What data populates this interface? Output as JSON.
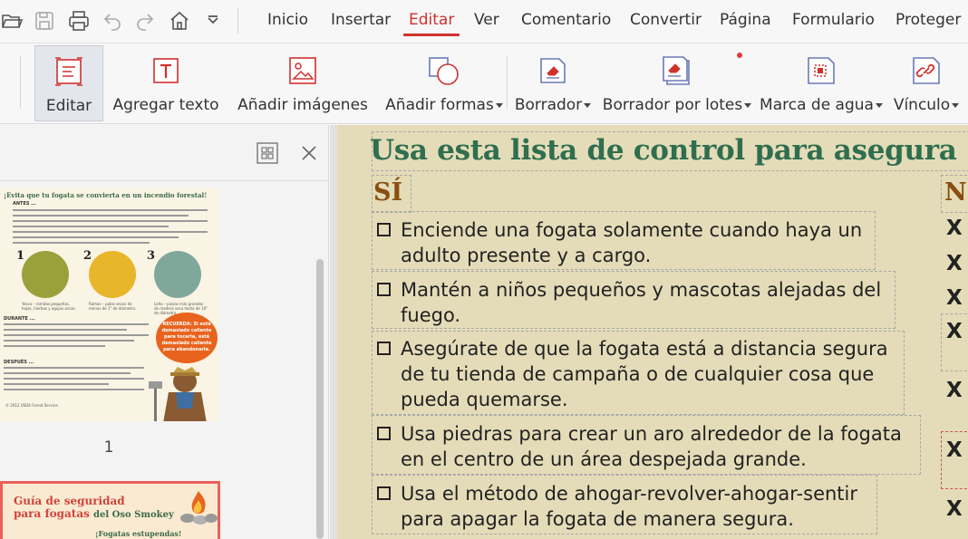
{
  "menu": {
    "tabs": [
      {
        "label": "Inicio",
        "active": false
      },
      {
        "label": "Insertar",
        "active": false
      },
      {
        "label": "Editar",
        "active": true
      },
      {
        "label": "Ver",
        "active": false
      },
      {
        "label": "Comentario",
        "active": false
      },
      {
        "label": "Convertir",
        "active": false
      },
      {
        "label": "Página",
        "active": false
      },
      {
        "label": "Formulario",
        "active": false
      },
      {
        "label": "Proteger",
        "active": false
      }
    ],
    "quick_access_icons": [
      "open-folder-icon",
      "save-icon",
      "print-icon",
      "undo-icon",
      "redo-icon",
      "home-icon",
      "chevron-down-icon"
    ]
  },
  "ribbon": {
    "buttons": [
      {
        "label": "Editar",
        "icon": "edit-text-icon",
        "active": true,
        "has_dropdown": false
      },
      {
        "label": "Agregar texto",
        "icon": "add-text-icon",
        "active": false,
        "has_dropdown": false
      },
      {
        "label": "Añadir imágenes",
        "icon": "add-image-icon",
        "active": false,
        "has_dropdown": false
      },
      {
        "label": "Añadir formas",
        "icon": "add-shape-icon",
        "active": false,
        "has_dropdown": true
      },
      {
        "label": "Borrador",
        "icon": "eraser-icon",
        "active": false,
        "has_dropdown": true
      },
      {
        "label": "Borrador por lotes",
        "icon": "batch-eraser-icon",
        "active": false,
        "has_dropdown": true
      },
      {
        "label": "Marca de agua",
        "icon": "watermark-icon",
        "active": false,
        "has_dropdown": true
      },
      {
        "label": "Vínculo",
        "icon": "link-icon",
        "active": false,
        "has_dropdown": true
      }
    ],
    "notification_color": "#e23b3b"
  },
  "sidebar": {
    "page_label": "1",
    "thumb1": {
      "title": "¡Evita que tu fogata se convierta en un incendio forestal!",
      "antes": "ANTES ...",
      "durante": "DURANTE ...",
      "despues": "DESPUÉS ...",
      "numbers": [
        "1",
        "2",
        "3"
      ],
      "captions": [
        "Yesca – ramitas pequeñas, hojas, hierbas y agujas secas.",
        "Ramas – palos secos de menos de 1\" de diámetro.",
        "Leña – piezas más grandes de madera seca hasta de 10\" de diámetro."
      ],
      "remember": "RECUERDA: Si está demasiado caliente para tocarla, está demasiado caliente para abandonarla.",
      "footer": "© 2012 USDA Forest Service."
    },
    "thumb2": {
      "title_line1": "Guía de seguridad",
      "title_line2": "para fogatas",
      "title_suffix": "del Oso Smokey",
      "subtitle": "¡Fogatas estupendas!"
    },
    "active_border_color": "#e8615a"
  },
  "document": {
    "heading": "Usa esta lista de control para asegura",
    "col_yes": "SÍ",
    "col_no": "N",
    "items": [
      {
        "lines": [
          "Enciende una fogata solamente cuando haya un",
          "adulto presente y a cargo."
        ]
      },
      {
        "lines": [
          "Mantén a niños pequeños y mascotas alejadas del",
          "fuego."
        ]
      },
      {
        "lines": [
          "Asegúrate de que la fogata está a distancia segura",
          "de tu tienda de campaña o de cualquier cosa que",
          "pueda quemarse."
        ]
      },
      {
        "lines": [
          "Usa piedras para crear un aro alrededor de la fogata",
          "en el centro de un área despejada grande."
        ]
      },
      {
        "lines": [
          "Usa el método de ahogar-revolver-ahogar-sentir",
          "para apagar la fogata de manera segura."
        ]
      }
    ],
    "no_marks": [
      "X",
      "X",
      "X",
      "X",
      "X",
      "X",
      "X"
    ],
    "heading_color": "#2f6e4f",
    "column_color": "#8a4e10",
    "page_color": "#e4dcb8"
  }
}
